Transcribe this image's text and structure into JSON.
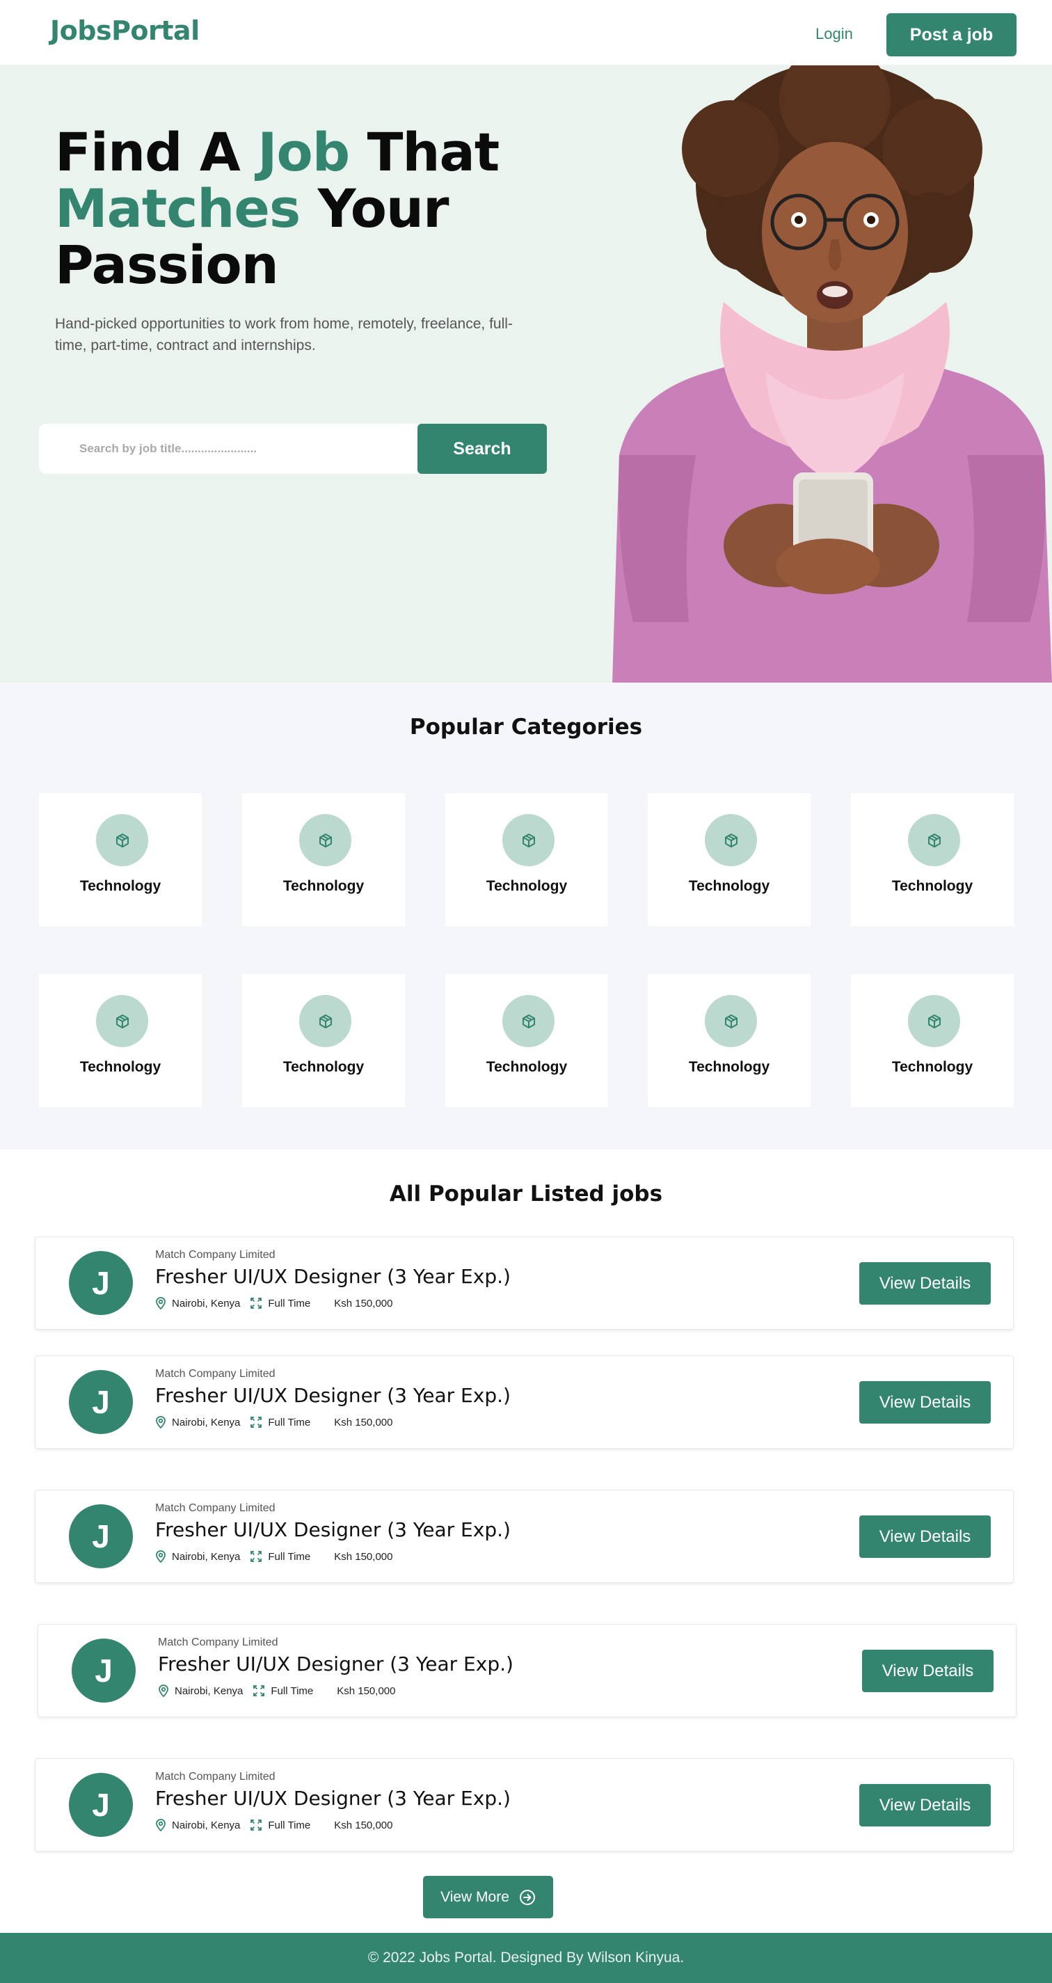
{
  "header": {
    "logo": "JobsPortal",
    "login_label": "Login",
    "post_job_label": "Post a job"
  },
  "hero": {
    "title_parts": [
      "Find A ",
      "Job",
      " That ",
      "Matches",
      " Your ",
      "Passion"
    ],
    "subtitle": "Hand-picked opportunities to work from home, remotely, freelance, full-time, part-time, contract and internships.",
    "search_placeholder": "Search by job title.......................",
    "search_button": "Search"
  },
  "categories": {
    "title": "Popular Categories",
    "items": [
      {
        "label": "Technology",
        "icon": "box-icon"
      },
      {
        "label": "Technology",
        "icon": "box-icon"
      },
      {
        "label": "Technology",
        "icon": "box-icon"
      },
      {
        "label": "Technology",
        "icon": "box-icon"
      },
      {
        "label": "Technology",
        "icon": "box-icon"
      },
      {
        "label": "Technology",
        "icon": "box-icon"
      },
      {
        "label": "Technology",
        "icon": "box-icon"
      },
      {
        "label": "Technology",
        "icon": "box-icon"
      },
      {
        "label": "Technology",
        "icon": "box-icon"
      },
      {
        "label": "Technology",
        "icon": "box-icon"
      }
    ]
  },
  "jobs": {
    "title": "All Popular Listed jobs",
    "items": [
      {
        "avatar": "J",
        "company": "Match Company Limited",
        "title": "Fresher UI/UX Designer (3 Year Exp.)",
        "location": "Nairobi, Kenya",
        "type": "Full Time",
        "salary": "Ksh 150,000",
        "button": "View Details"
      },
      {
        "avatar": "J",
        "company": "Match Company Limited",
        "title": "Fresher UI/UX Designer (3 Year Exp.)",
        "location": "Nairobi, Kenya",
        "type": "Full Time",
        "salary": "Ksh 150,000",
        "button": "View Details"
      },
      {
        "avatar": "J",
        "company": "Match Company Limited",
        "title": "Fresher UI/UX Designer (3 Year Exp.)",
        "location": "Nairobi, Kenya",
        "type": "Full Time",
        "salary": "Ksh 150,000",
        "button": "View Details"
      },
      {
        "avatar": "J",
        "company": "Match Company Limited",
        "title": "Fresher UI/UX Designer (3 Year Exp.)",
        "location": "Nairobi, Kenya",
        "type": "Full Time",
        "salary": "Ksh 150,000",
        "button": "View Details"
      },
      {
        "avatar": "J",
        "company": "Match Company Limited",
        "title": "Fresher UI/UX Designer (3 Year Exp.)",
        "location": "Nairobi, Kenya",
        "type": "Full Time",
        "salary": "Ksh 150,000",
        "button": "View Details"
      }
    ],
    "view_more_label": "View More"
  },
  "footer": {
    "text": "© 2022 Jobs Portal. Designed By Wilson Kinyua."
  },
  "colors": {
    "brand": "#33856f",
    "hero_bg": "#ebf3ee",
    "category_bg": "#f4f6f9",
    "category_circle": "#bcd9cf"
  }
}
